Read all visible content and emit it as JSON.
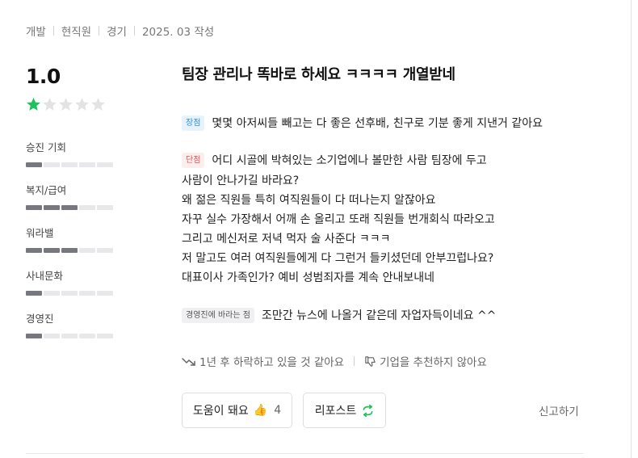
{
  "meta": {
    "job": "개발",
    "status": "현직원",
    "region": "경기",
    "date": "2025. 03 작성"
  },
  "rating": {
    "score": "1.0",
    "stars": 1,
    "max_stars": 5
  },
  "criteria": [
    {
      "label": "승진 기회",
      "value": 1
    },
    {
      "label": "복지/급여",
      "value": 3
    },
    {
      "label": "워라밸",
      "value": 3
    },
    {
      "label": "사내문화",
      "value": 1
    },
    {
      "label": "경영진",
      "value": 1
    }
  ],
  "review": {
    "title": "팀장 관리나 똑바로 하세요 ㅋㅋㅋㅋ 개열받네",
    "pros": {
      "tag": "장점",
      "text": "몇몇 아저씨들 빼고는 다 좋은 선후배, 친구로 기분 좋게 지낸거 같아요"
    },
    "cons": {
      "tag": "단점",
      "first": "어디 시골에 박혀있는 소기업에나 볼만한 사람 팀장에 두고",
      "lines": [
        "사람이 안나가길 바라요?",
        "왜 젊은 직원들 특히 여직원들이 다 떠나는지 알잖아요",
        "자꾸 실수 가장해서 어깨 손 올리고 또래 직원들 번개회식 따라오고",
        "그리고 메신저로 저녁 먹자 술 사준다 ㅋㅋㅋ",
        "저 말고도 여러 여직원들에게 다 그런거 들키셨던데 안부끄럽나요?",
        "대표이사 가족인가? 예비 성범죄자를 계속 안내보내네"
      ]
    },
    "management": {
      "tag": "경영진에 바라는 점",
      "text": "조만간 뉴스에 나올거 같은데 자업자득이네요 ^^"
    }
  },
  "outlook": {
    "growth": "1년 후 하락하고 있을 것 같아요",
    "recommend": "기업을 추천하지 않아요"
  },
  "actions": {
    "helpful_label": "도움이 돼요",
    "helpful_emoji": "👍",
    "helpful_count": "4",
    "repost_label": "리포스트",
    "report_label": "신고하기"
  },
  "colors": {
    "star_on": "#1ec25b",
    "star_off": "#e3e3e6",
    "bar_on": "#77777e",
    "bar_off": "#e8e8ea",
    "repost_icon": "#1ec25b"
  },
  "icons": {
    "trend": "trend-down-icon",
    "thumb": "thumbs-down-icon",
    "repost": "repost-icon"
  }
}
